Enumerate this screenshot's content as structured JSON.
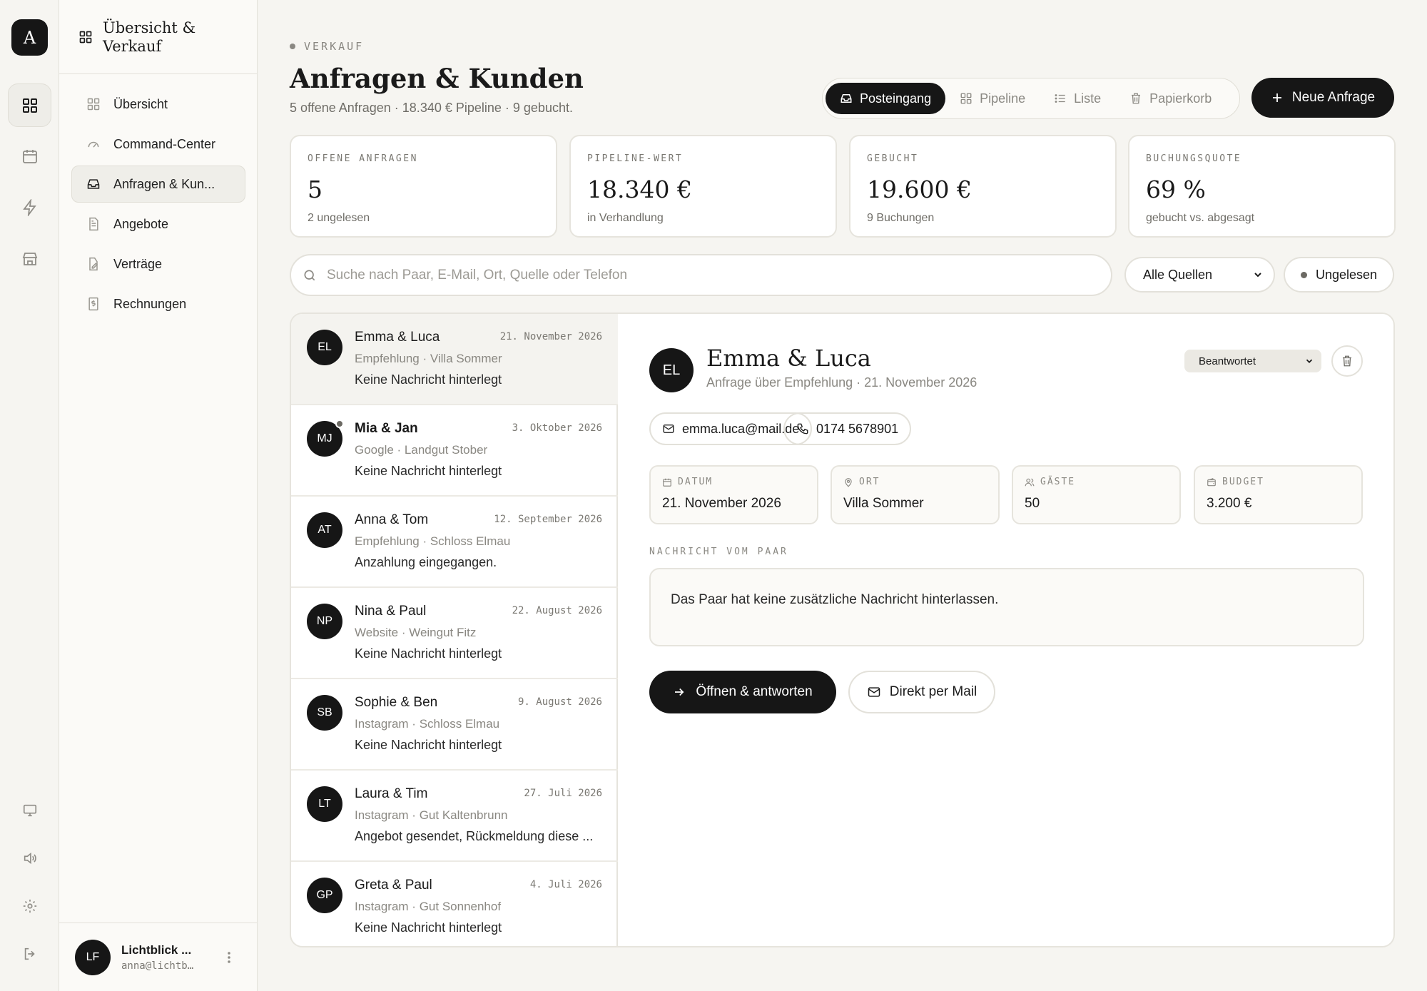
{
  "rail": {
    "logo_letter": "A",
    "items": [
      "grid-icon",
      "calendar-icon",
      "bolt-icon",
      "store-icon"
    ],
    "bottom_items": [
      "monitor-icon",
      "speaker-icon",
      "gear-icon",
      "logout-icon"
    ]
  },
  "sidebar": {
    "title": "Übersicht & Verkauf",
    "items": [
      {
        "label": "Übersicht",
        "icon": "grid-icon"
      },
      {
        "label": "Command-Center",
        "icon": "gauge-icon"
      },
      {
        "label": "Anfragen & Kun...",
        "icon": "inbox-icon",
        "active": true
      },
      {
        "label": "Angebote",
        "icon": "document-icon"
      },
      {
        "label": "Verträge",
        "icon": "contract-icon"
      },
      {
        "label": "Rechnungen",
        "icon": "invoice-icon"
      }
    ],
    "user": {
      "initials": "LF",
      "name": "Lichtblick ...",
      "email": "anna@lichtb…"
    }
  },
  "header": {
    "eyebrow": "VERKAUF",
    "title": "Anfragen & Kunden",
    "subtitle": "5 offene Anfragen · 18.340 € Pipeline · 9 gebucht.",
    "tabs": [
      {
        "label": "Posteingang",
        "icon": "inbox-icon",
        "active": true
      },
      {
        "label": "Pipeline",
        "icon": "grid-icon"
      },
      {
        "label": "Liste",
        "icon": "list-icon"
      },
      {
        "label": "Papierkorb",
        "icon": "trash-icon"
      }
    ],
    "new_button": "Neue Anfrage"
  },
  "stats": [
    {
      "label": "OFFENE ANFRAGEN",
      "value": "5",
      "sub": "2 ungelesen"
    },
    {
      "label": "PIPELINE-WERT",
      "value": "18.340 €",
      "sub": "in Verhandlung"
    },
    {
      "label": "GEBUCHT",
      "value": "19.600 €",
      "sub": "9 Buchungen"
    },
    {
      "label": "BUCHUNGSQUOTE",
      "value": "69 %",
      "sub": "gebucht vs. abgesagt"
    }
  ],
  "filters": {
    "search_placeholder": "Suche nach Paar, E-Mail, Ort, Quelle oder Telefon",
    "source_select": "Alle Quellen",
    "unread_chip": "Ungelesen"
  },
  "inquiries": [
    {
      "initials": "EL",
      "name": "Emma & Luca",
      "date": "21. November 2026",
      "meta": "Empfehlung · Villa Sommer",
      "message": "Keine Nachricht hinterlegt",
      "selected": true,
      "unread": false
    },
    {
      "initials": "MJ",
      "name": "Mia & Jan",
      "date": "3. Oktober 2026",
      "meta": "Google · Landgut Stober",
      "message": "Keine Nachricht hinterlegt",
      "selected": false,
      "unread": true
    },
    {
      "initials": "AT",
      "name": "Anna & Tom",
      "date": "12. September 2026",
      "meta": "Empfehlung · Schloss Elmau",
      "message": "Anzahlung eingegangen.",
      "selected": false,
      "unread": false
    },
    {
      "initials": "NP",
      "name": "Nina & Paul",
      "date": "22. August 2026",
      "meta": "Website · Weingut Fitz",
      "message": "Keine Nachricht hinterlegt",
      "selected": false,
      "unread": false
    },
    {
      "initials": "SB",
      "name": "Sophie & Ben",
      "date": "9. August 2026",
      "meta": "Instagram · Schloss Elmau",
      "message": "Keine Nachricht hinterlegt",
      "selected": false,
      "unread": false
    },
    {
      "initials": "LT",
      "name": "Laura & Tim",
      "date": "27. Juli 2026",
      "meta": "Instagram · Gut Kaltenbrunn",
      "message": "Angebot gesendet, Rückmeldung diese ...",
      "selected": false,
      "unread": false
    },
    {
      "initials": "GP",
      "name": "Greta & Paul",
      "date": "4. Juli 2026",
      "meta": "Instagram · Gut Sonnenhof",
      "message": "Keine Nachricht hinterlegt",
      "selected": false,
      "unread": false
    }
  ],
  "detail": {
    "initials": "EL",
    "name": "Emma & Luca",
    "subtitle": "Anfrage über Empfehlung · 21. November 2026",
    "status": "Beantwortet",
    "email": "emma.luca@mail.de",
    "phone": "0174 5678901",
    "facts": [
      {
        "label": "DATUM",
        "value": "21. November 2026",
        "icon": "calendar-icon"
      },
      {
        "label": "ORT",
        "value": "Villa Sommer",
        "icon": "pin-icon"
      },
      {
        "label": "GÄSTE",
        "value": "50",
        "icon": "users-icon"
      },
      {
        "label": "BUDGET",
        "value": "3.200 €",
        "icon": "wallet-icon"
      }
    ],
    "message_label": "NACHRICHT VOM PAAR",
    "message": "Das Paar hat keine zusätzliche Nachricht hinterlassen.",
    "primary_button": "Öffnen & antworten",
    "secondary_button": "Direkt per Mail"
  }
}
